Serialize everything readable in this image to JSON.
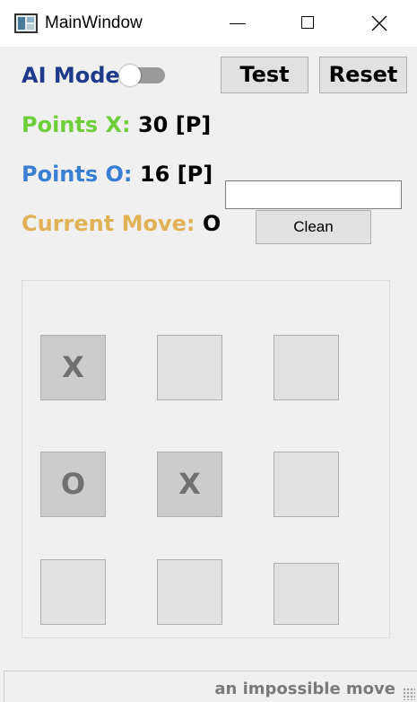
{
  "window": {
    "title": "MainWindow"
  },
  "controls": {
    "ai_mode_label": "AI Mode",
    "ai_mode_on": false,
    "test_label": "Test",
    "reset_label": "Reset",
    "clean_label": "Clean",
    "input_value": ""
  },
  "stats": {
    "points_x_label": "Points X:",
    "points_x_value": "30 [P]",
    "points_o_label": "Points O:",
    "points_o_value": "16 [P]",
    "current_move_label": "Current Move:",
    "current_move_value": "O"
  },
  "board": {
    "cells": [
      "X",
      "",
      "",
      "O",
      "X",
      "",
      "",
      "",
      ""
    ]
  },
  "status": {
    "message": "an impossible move"
  },
  "colors": {
    "ai_label": "#1e3a8a",
    "points_x": "#6fcf3a",
    "points_o": "#3a7fd4",
    "current_move": "#e0b255"
  }
}
